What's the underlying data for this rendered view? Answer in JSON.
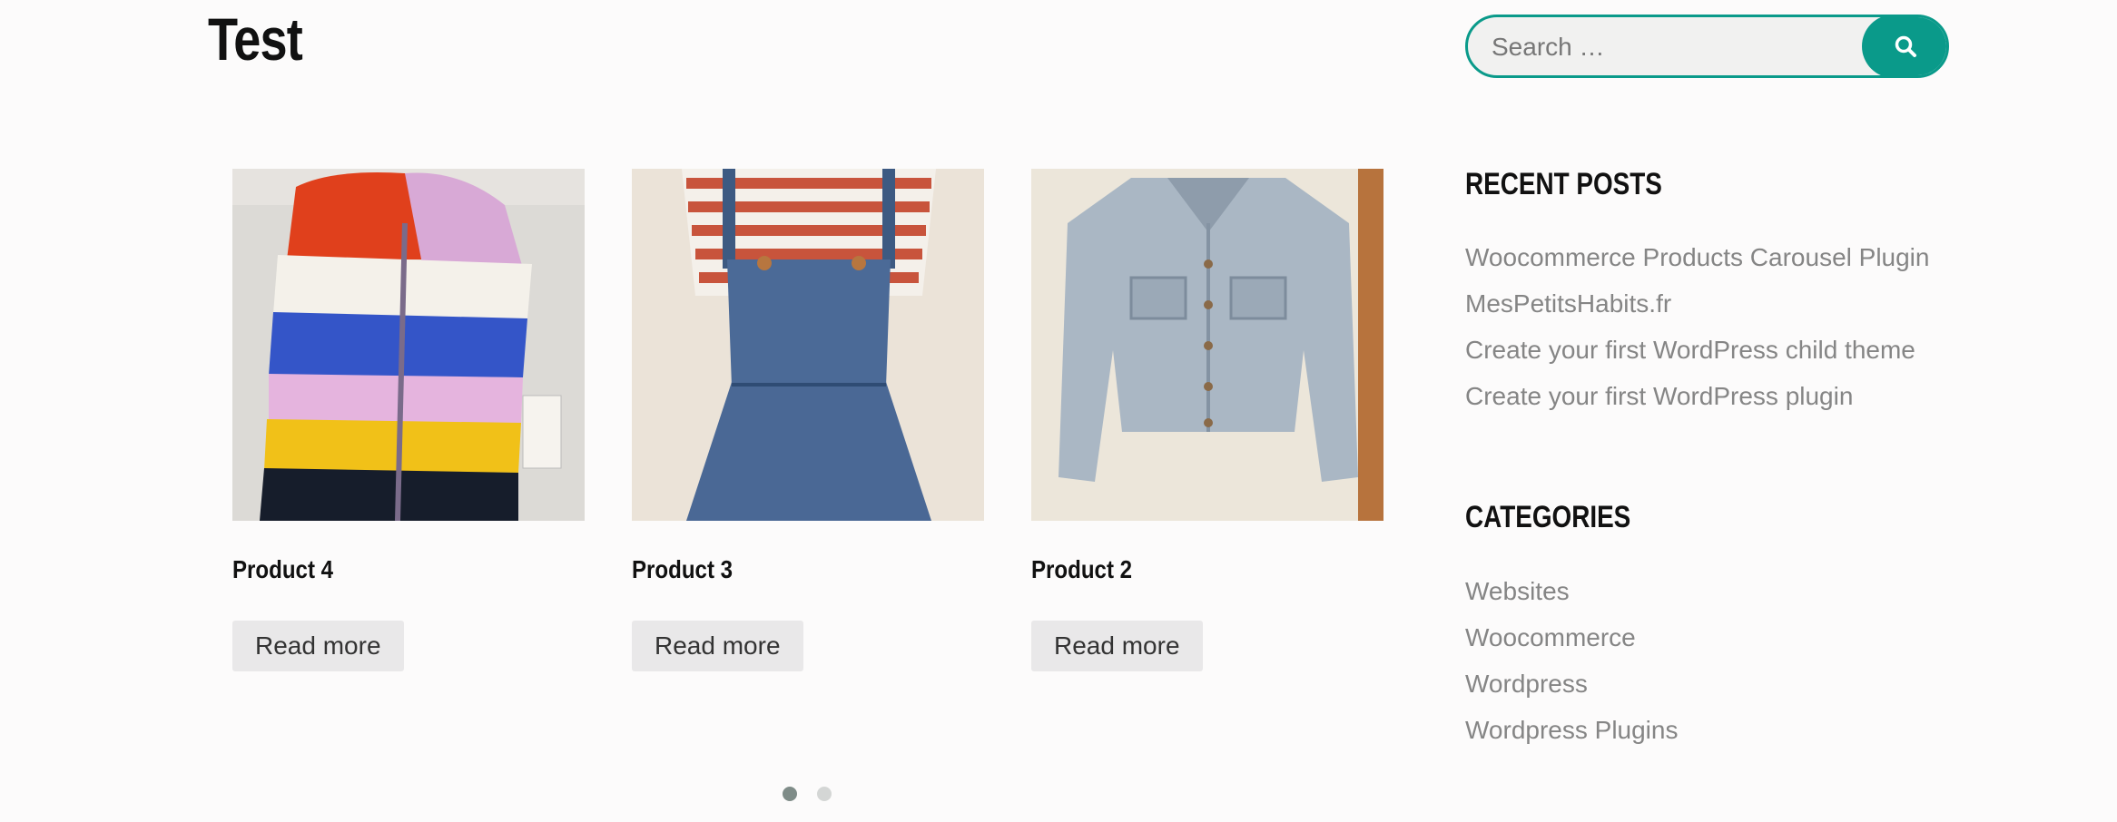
{
  "page": {
    "title": "Test"
  },
  "carousel": {
    "products": [
      {
        "title": "Product 4",
        "button_label": "Read more",
        "image": "rainbow-puffer-vest"
      },
      {
        "title": "Product 3",
        "button_label": "Read more",
        "image": "denim-overall-dress"
      },
      {
        "title": "Product 2",
        "button_label": "Read more",
        "image": "denim-jacket"
      }
    ],
    "dots": {
      "count": 2,
      "active_index": 0
    }
  },
  "sidebar": {
    "search": {
      "placeholder": "Search …",
      "button_icon": "search-icon",
      "accent": "#0a9a8a"
    },
    "recent_posts": {
      "title": "RECENT POSTS",
      "items": [
        "Woocommerce Products Carousel Plugin",
        "MesPetitsHabits.fr",
        "Create your first WordPress child theme",
        "Create your first WordPress plugin"
      ]
    },
    "categories": {
      "title": "CATEGORIES",
      "items": [
        "Websites",
        "Woocommerce",
        "Wordpress",
        "Wordpress Plugins"
      ]
    }
  }
}
